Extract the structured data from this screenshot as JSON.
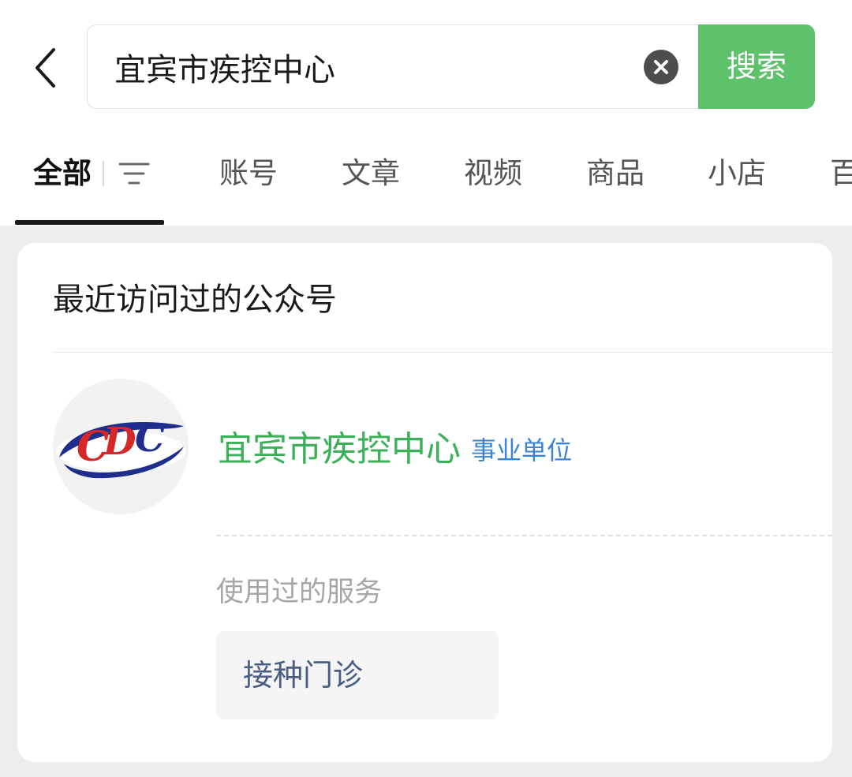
{
  "search": {
    "query": "宜宾市疾控中心",
    "button_label": "搜索"
  },
  "tabs": [
    {
      "label": "全部",
      "active": true
    },
    {
      "label": "账号"
    },
    {
      "label": "文章"
    },
    {
      "label": "视频"
    },
    {
      "label": "商品"
    },
    {
      "label": "小店"
    },
    {
      "label": "百"
    }
  ],
  "recent": {
    "title": "最近访问过的公众号",
    "account": {
      "name": "宜宾市疾控中心",
      "badge": "事业单位",
      "avatar_icon": "cdc-logo"
    },
    "services_label": "使用过的服务",
    "services": [
      "接种门诊"
    ]
  },
  "colors": {
    "accent_green": "#5ec26a",
    "account_name_green": "#3cb058",
    "badge_blue": "#3a84d6",
    "logo_navy": "#1f2e8c",
    "logo_red": "#d62828"
  }
}
